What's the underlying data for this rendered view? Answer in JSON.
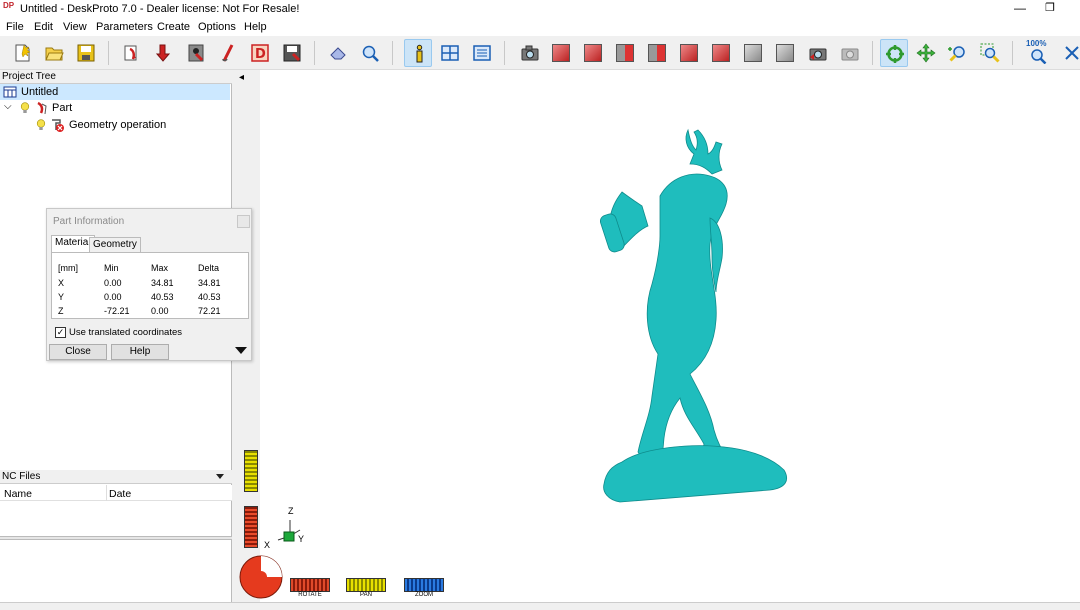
{
  "window": {
    "title": "Untitled - DeskProto 7.0 - Dealer license: Not For Resale!",
    "logo_text": "DP",
    "minimize_glyph": "—",
    "maximize_glyph": "❐"
  },
  "menu": [
    "File",
    "Edit",
    "View",
    "Parameters",
    "Create",
    "Options",
    "Help"
  ],
  "toolbar": {
    "zoom_percent_label": "100%"
  },
  "project_tree": {
    "header": "Project Tree",
    "items": [
      {
        "label": "Untitled",
        "icon": "project-icon"
      },
      {
        "label": "Part",
        "icon": "part-icon"
      },
      {
        "label": "Geometry operation",
        "icon": "geometry-operation-icon"
      }
    ]
  },
  "nc_files": {
    "header": "NC Files",
    "columns": [
      "Name",
      "Date"
    ]
  },
  "part_info": {
    "title": "Part Information",
    "tabs": [
      "Material",
      "Geometry"
    ],
    "headers": [
      "[mm]",
      "Min",
      "Max",
      "Delta"
    ],
    "rows": [
      {
        "axis": "X",
        "min": "0.00",
        "max": "34.81",
        "delta": "34.81"
      },
      {
        "axis": "Y",
        "min": "0.00",
        "max": "40.53",
        "delta": "40.53"
      },
      {
        "axis": "Z",
        "min": "-72.21",
        "max": "0.00",
        "delta": "72.21"
      }
    ],
    "checkbox_label": "Use translated coordinates",
    "checkbox_checked": "✓",
    "close_label": "Close",
    "help_label": "Help"
  },
  "viewport": {
    "controls": [
      "ROTATE",
      "PAN",
      "ZOOM"
    ],
    "axes": {
      "x": "X",
      "y": "Y",
      "z": "Z"
    },
    "collapse_glyph": "◂",
    "model_color": "#1fbdbd"
  }
}
